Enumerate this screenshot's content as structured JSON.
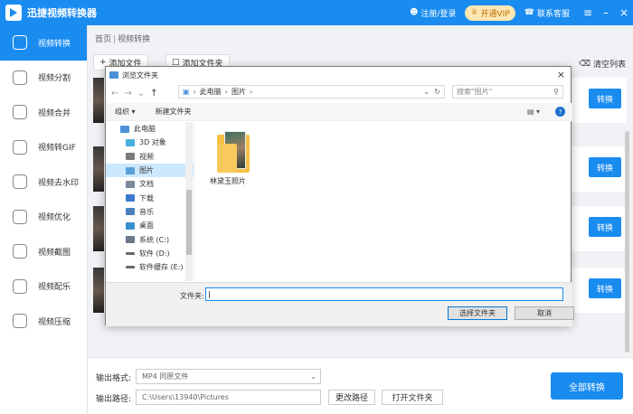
{
  "app": {
    "title": "迅捷视频转换器",
    "login": "注册/登录",
    "vip": "开通VIP",
    "support": "联系客服"
  },
  "sidebar": {
    "items": [
      {
        "label": "视频转换",
        "icon": "convert-icon"
      },
      {
        "label": "视频分割",
        "icon": "split-icon"
      },
      {
        "label": "视频合并",
        "icon": "merge-icon"
      },
      {
        "label": "视频转GIF",
        "icon": "gif-icon"
      },
      {
        "label": "视频去水印",
        "icon": "watermark-icon"
      },
      {
        "label": "视频优化",
        "icon": "optimize-icon"
      },
      {
        "label": "视频截图",
        "icon": "screenshot-icon"
      },
      {
        "label": "视频配乐",
        "icon": "music-icon"
      },
      {
        "label": "视频压缩",
        "icon": "compress-icon"
      }
    ]
  },
  "main": {
    "breadcrumb": [
      "首页",
      "视频转换"
    ],
    "add_file": "添加文件",
    "add_folder": "添加文件夹",
    "clear_list": "清空列表",
    "convert_label": "转换"
  },
  "bottom": {
    "format_label": "输出格式:",
    "format_value": "MP4  同原文件",
    "path_label": "输出路径:",
    "path_value": "C:\\Users\\13940\\Pictures",
    "change_path": "更改路径",
    "open_folder": "打开文件夹",
    "convert_all": "全部转换"
  },
  "dialog": {
    "title": "浏览文件夹",
    "path": [
      "此电脑",
      "图片"
    ],
    "search_placeholder": "搜索\"图片\"",
    "organize": "组织",
    "new_folder": "新建文件夹",
    "tree": [
      {
        "label": "此电脑",
        "color": "#4a90d9"
      },
      {
        "label": "3D 对象",
        "color": "#4ab0e0"
      },
      {
        "label": "视频",
        "color": "#7a7a7a"
      },
      {
        "label": "图片",
        "color": "#5aa0d8"
      },
      {
        "label": "文档",
        "color": "#7a8a9a"
      },
      {
        "label": "下载",
        "color": "#3a7ad0"
      },
      {
        "label": "音乐",
        "color": "#4a80c0"
      },
      {
        "label": "桌面",
        "color": "#3a90d0"
      },
      {
        "label": "系统 (C:)",
        "color": "#6a7a8a"
      },
      {
        "label": "软件 (D:)",
        "color": "#6a6a6a"
      },
      {
        "label": "软件缓存 (E:)",
        "color": "#6a6a6a"
      }
    ],
    "folder_name": "林黛玉照片",
    "folder_field_label": "文件夹:",
    "select_button": "选择文件夹",
    "cancel_button": "取消"
  }
}
